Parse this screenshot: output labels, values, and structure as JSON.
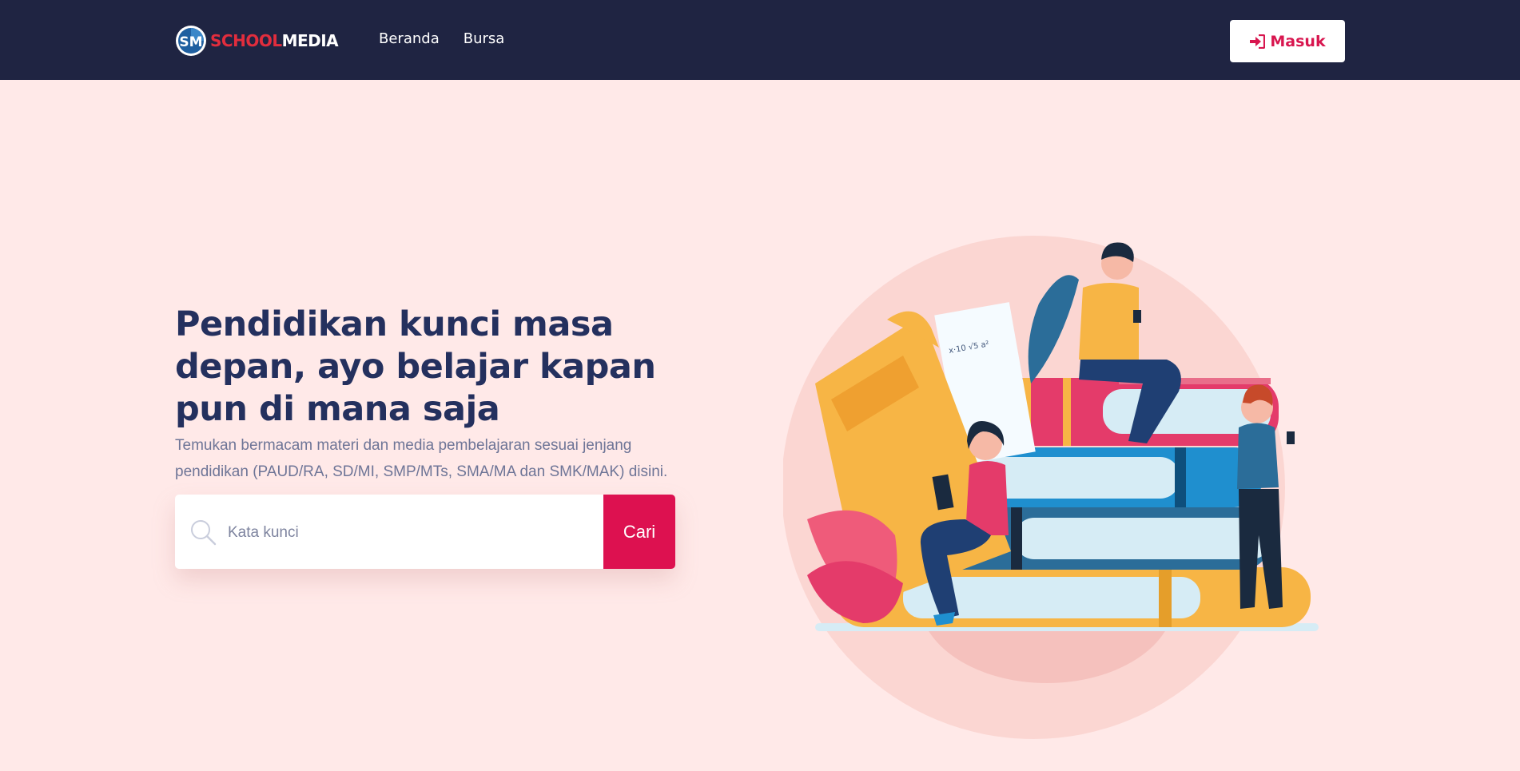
{
  "brand": {
    "logo_mark": "SM",
    "logo_part1": "SCHOOL",
    "logo_part2": "MEDIA"
  },
  "nav": {
    "items": [
      {
        "label": "Beranda"
      },
      {
        "label": "Bursa"
      }
    ]
  },
  "login": {
    "label": "Masuk",
    "icon": "sign-in-icon"
  },
  "hero": {
    "title": "Pendidikan kunci masa depan, ayo belajar kapan pun di mana saja",
    "subtitle": "Temukan bermacam materi dan media pembelajaran sesuai jenjang pendidikan (PAUD/RA, SD/MI, SMP/MTs, SMA/MA dan SMK/MAK) disini."
  },
  "search": {
    "placeholder": "Kata kunci",
    "button_label": "Cari",
    "icon": "search-icon"
  },
  "colors": {
    "navbar": "#1f2442",
    "page_bg": "#ffe9e8",
    "accent": "#dd1150",
    "heading": "#24305e",
    "body_text": "#6e7597",
    "logo_red": "#e12d3d"
  },
  "illustration": {
    "description_icon": "students-reading-books-illustration"
  }
}
